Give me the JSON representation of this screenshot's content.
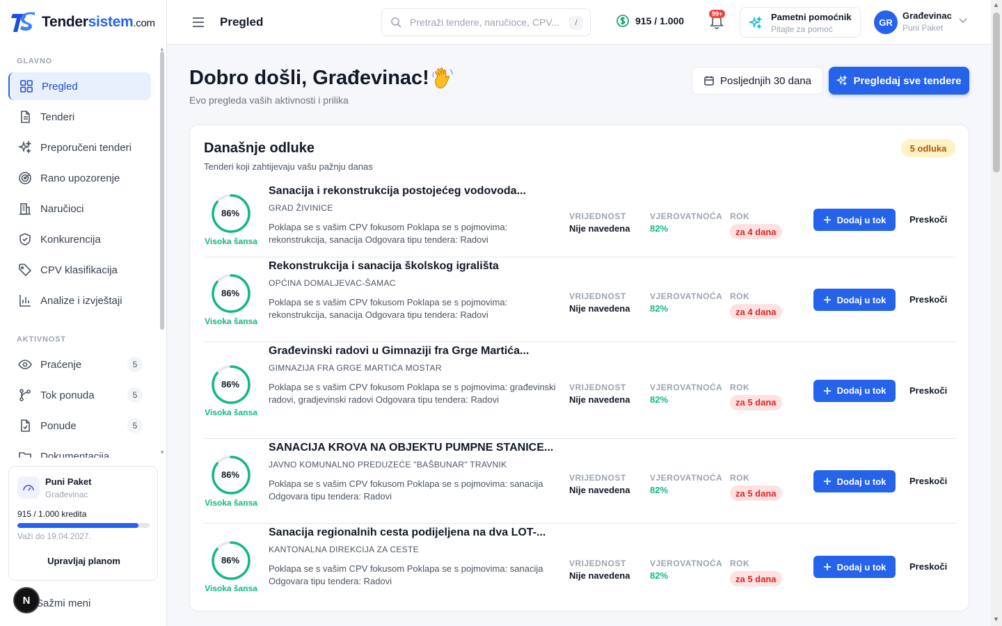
{
  "brand": {
    "name_dark": "Tender",
    "name_blue": "sistem",
    "domain": ".com"
  },
  "sidebar": {
    "section_main": "GLAVNO",
    "section_activity": "AKTIVNOST",
    "main_items": [
      {
        "label": "Pregled",
        "icon": "grid-icon"
      },
      {
        "label": "Tenderi",
        "icon": "document-icon"
      },
      {
        "label": "Preporučeni tenderi",
        "icon": "sparkles-icon"
      },
      {
        "label": "Rano upozorenje",
        "icon": "radar-icon"
      },
      {
        "label": "Naručioci",
        "icon": "building-icon"
      },
      {
        "label": "Konkurencija",
        "icon": "shield-icon"
      },
      {
        "label": "CPV klasifikacija",
        "icon": "tag-icon"
      },
      {
        "label": "Analize i izvještaji",
        "icon": "bar-chart-icon"
      }
    ],
    "activity_items": [
      {
        "label": "Praćenje",
        "icon": "eye-icon",
        "count": "5"
      },
      {
        "label": "Tok ponuda",
        "icon": "workflow-icon",
        "count": "5"
      },
      {
        "label": "Ponude",
        "icon": "file-check-icon",
        "count": "5"
      },
      {
        "label": "Dokumentacija",
        "icon": "folder-icon"
      }
    ],
    "plan": {
      "name": "Puni Paket",
      "company": "Građevinac",
      "credits": "915 / 1.000 kredita",
      "credits_fraction": 0.915,
      "valid_until": "Važi do 19.04.2027.",
      "manage": "Upravljaj planom"
    },
    "collapse": "Sažmi meni",
    "bubble_letter": "N"
  },
  "header": {
    "title": "Pregled",
    "search_placeholder": "Pretraži tendere, naručioce, CPV...",
    "search_shortcut": "/",
    "credits": "915 / 1.000",
    "notifications_badge": "99+",
    "assistant_title": "Pametni pomoćnik",
    "assistant_sub": "Pitajte za pomoć",
    "user_initials": "GR",
    "user_name": "Građevinac",
    "user_plan": "Puni Paket"
  },
  "main": {
    "welcome": "Dobro došli, Građevinac!",
    "welcome_sub": "Evo pregleda vaših aktivnosti i prilika",
    "period_button": "Posljednjih 30 dana",
    "all_button": "Pregledaj sve tendere"
  },
  "decisions": {
    "title": "Današnje odluke",
    "subtitle": "Tenderi koji zahtijevaju vašu pažnju danas",
    "badge": "5 odluka",
    "label_value": "VRIJEDNOST",
    "label_probability": "VJEROVATNOĆA",
    "label_deadline": "ROK",
    "add_label": "Dodaj u tok",
    "skip_label": "Preskoči",
    "items": [
      {
        "score": "86%",
        "score_fraction": 0.86,
        "score_label": "Visoka šansa",
        "title": "Sanacija i rekonstrukcija postojećeg vodovoda...",
        "buyer": "GRAD ŽIVINICE",
        "desc": "Poklapa se s vašim CPV fokusom Poklapa se s pojmovima: rekonstrukcija, sanacija Odgovara tipu tendera: Radovi",
        "value": "Nije navedena",
        "probability": "82%",
        "deadline": "za 4 dana"
      },
      {
        "score": "86%",
        "score_fraction": 0.86,
        "score_label": "Visoka šansa",
        "title": "Rekonstrukcija i sanacija školskog igrališta",
        "buyer": "OPĆINA DOMALJEVAC-ŠAMAC",
        "desc": "Poklapa se s vašim CPV fokusom Poklapa se s pojmovima: rekonstrukcija, sanacija Odgovara tipu tendera: Radovi",
        "value": "Nije navedena",
        "probability": "82%",
        "deadline": "za 4 dana"
      },
      {
        "score": "86%",
        "score_fraction": 0.86,
        "score_label": "Visoka šansa",
        "title": "Građevinski radovi u Gimnaziji fra Grge Martića...",
        "buyer": "GIMNAZIJA FRA GRGE MARTIĆA MOSTAR",
        "desc": "Poklapa se s vašim CPV fokusom Poklapa se s pojmovima: građevinski radovi, gradjevinski radovi Odgovara tipu tendera: Radovi",
        "value": "Nije navedena",
        "probability": "82%",
        "deadline": "za 5 dana"
      },
      {
        "score": "86%",
        "score_fraction": 0.86,
        "score_label": "Visoka šansa",
        "title": "SANACIJA KROVA NA OBJEKTU PUMPNE STANICE...",
        "buyer": "JAVNO KOMUNALNO PREDUZEĆE \"BAŠBUNAR\" TRAVNIK",
        "desc": "Poklapa se s vašim CPV fokusom Poklapa se s pojmovima: sanacija Odgovara tipu tendera: Radovi",
        "value": "Nije navedena",
        "probability": "82%",
        "deadline": "za 5 dana"
      },
      {
        "score": "86%",
        "score_fraction": 0.86,
        "score_label": "Visoka šansa",
        "title": "Sanacija regionalnih cesta podijeljena na dva LOT-...",
        "buyer": "KANTONALNA DIREKCIJA ZA CESTE",
        "desc": "Poklapa se s vašim CPV fokusom Poklapa se s pojmovima: sanacija Odgovara tipu tendera: Radovi",
        "value": "Nije navedena",
        "probability": "82%",
        "deadline": "za 5 dana"
      }
    ]
  },
  "colors": {
    "accent": "#2563eb",
    "success": "#10b981",
    "danger": "#dc2626",
    "warning_bg": "#fef3c7"
  }
}
